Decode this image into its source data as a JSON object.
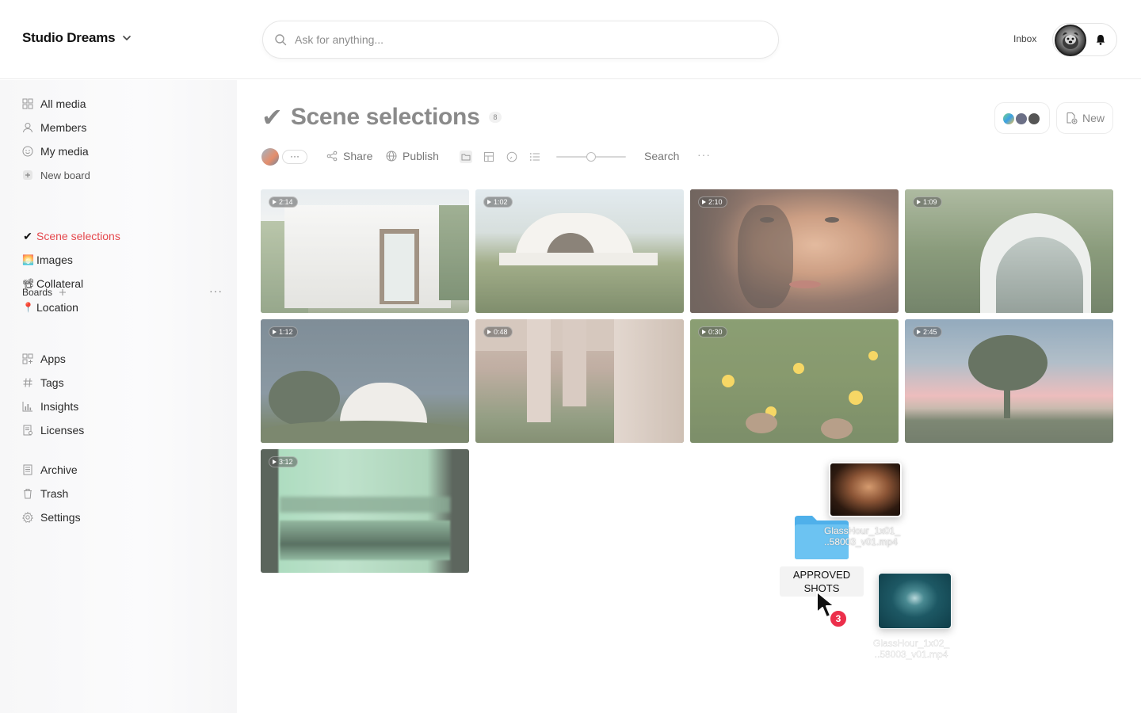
{
  "header": {
    "workspace_name": "Studio Dreams",
    "search_placeholder": "Ask for anything...",
    "inbox_label": "Inbox"
  },
  "sidebar": {
    "top_items": [
      {
        "label": "All media",
        "icon": "grid-icon"
      },
      {
        "label": "Members",
        "icon": "person-icon"
      },
      {
        "label": "My media",
        "icon": "smiley-icon"
      },
      {
        "label": "New board",
        "icon": "plus-square-icon"
      }
    ],
    "boards_label": "Boards",
    "boards": [
      {
        "label": "Scene selections",
        "emoji": "✔",
        "active": true
      },
      {
        "label": "Images",
        "emoji": "🌅"
      },
      {
        "label": "Collateral",
        "emoji": "📽"
      },
      {
        "label": "Location",
        "emoji": "📍"
      }
    ],
    "tool_items": [
      {
        "label": "Apps",
        "icon": "apps-icon"
      },
      {
        "label": "Tags",
        "icon": "hash-icon"
      },
      {
        "label": "Insights",
        "icon": "bar-chart-icon"
      },
      {
        "label": "Licenses",
        "icon": "license-icon"
      }
    ],
    "bottom_items": [
      {
        "label": "Archive",
        "icon": "archive-icon"
      },
      {
        "label": "Trash",
        "icon": "trash-icon"
      },
      {
        "label": "Settings",
        "icon": "gear-icon"
      }
    ]
  },
  "main": {
    "title": "Scene selections",
    "item_count": "8",
    "new_button_label": "New",
    "toolbar": {
      "more_label": "···",
      "share_label": "Share",
      "publish_label": "Publish",
      "search_label": "Search",
      "ellipsis": "···",
      "zoom_level": 0.5
    },
    "media": [
      {
        "duration": "2:14",
        "subject": "modern white house"
      },
      {
        "duration": "1:02",
        "subject": "curved white villa on hill"
      },
      {
        "duration": "2:10",
        "subject": "woman close-up portrait"
      },
      {
        "duration": "1:09",
        "subject": "glass arch house in forest"
      },
      {
        "duration": "1:12",
        "subject": "white dome house by tree"
      },
      {
        "duration": "0:48",
        "subject": "concrete pillars interior"
      },
      {
        "duration": "0:30",
        "subject": "rabbits in yellow flower field"
      },
      {
        "duration": "2:45",
        "subject": "lone tree at dusk"
      },
      {
        "duration": "3:12",
        "subject": "motion blurred landscape through window"
      }
    ]
  },
  "drag": {
    "file1_line1": "GlassHour_1x01_",
    "file1_line2": "..58003_v01.mp4",
    "folder_label_line1": "APPROVED",
    "folder_label_line2": "SHOTS",
    "file2_line1": "GlassHour_1x02_",
    "file2_line2": "..58003_v01.mp4",
    "count": "3"
  },
  "colors": {
    "active_board": "#e5484d",
    "folder_blue": "#5ab8ef",
    "badge_red": "#ec2f4b"
  }
}
